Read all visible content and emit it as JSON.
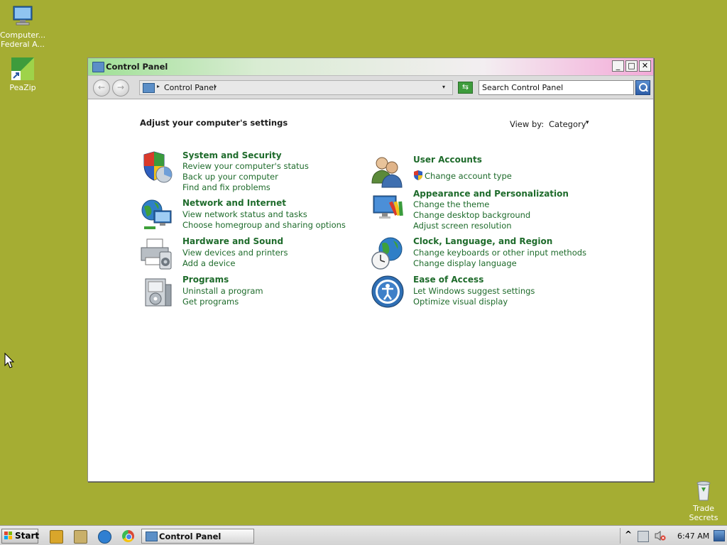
{
  "desktop": {
    "icons": [
      {
        "label": "Computer... Federal A..."
      },
      {
        "label": "PeaZip"
      },
      {
        "label": "Trade Secrets"
      }
    ]
  },
  "window": {
    "title": "Control Panel",
    "minimize_symbol": "_",
    "maximize_symbol": "□",
    "close_symbol": "✕",
    "toolbar": {
      "back_symbol": "←",
      "forward_symbol": "→",
      "breadcrumb_sep": "▸",
      "breadcrumb": "Control Panel",
      "breadcrumb_arrow": "▾",
      "dropdown_arrow": "▾",
      "refresh_symbol": "⇆",
      "search_placeholder": "Search Control Panel"
    },
    "content": {
      "heading": "Adjust your computer's settings",
      "view_by_label": "View by:",
      "view_by_value": "Category",
      "view_by_arrow": "▾",
      "categories_left": [
        {
          "title": "System and Security",
          "links": [
            "Review your computer's status",
            "Back up your computer",
            "Find and fix problems"
          ]
        },
        {
          "title": "Network and Internet",
          "links": [
            "View network status and tasks",
            "Choose homegroup and sharing options"
          ]
        },
        {
          "title": "Hardware and Sound",
          "links": [
            "View devices and printers",
            "Add a device"
          ]
        },
        {
          "title": "Programs",
          "links": [
            "Uninstall a program",
            "Get programs"
          ]
        }
      ],
      "categories_right": [
        {
          "title": "User Accounts",
          "links": [
            "Change account type"
          ]
        },
        {
          "title": "Appearance and Personalization",
          "links": [
            "Change the theme",
            "Change desktop background",
            "Adjust screen resolution"
          ]
        },
        {
          "title": "Clock, Language, and Region",
          "links": [
            "Change keyboards or other input methods",
            "Change display language"
          ]
        },
        {
          "title": "Ease of Access",
          "links": [
            "Let Windows suggest settings",
            "Optimize visual display"
          ]
        }
      ]
    }
  },
  "taskbar": {
    "start_label": "Start",
    "quick_launch": [
      {
        "name": "media-player-icon",
        "color": "#d9a62b"
      },
      {
        "name": "folder-icon",
        "color": "#c9b06a"
      },
      {
        "name": "internet-explorer-icon",
        "color": "#2f7fd1"
      },
      {
        "name": "chrome-icon",
        "color": "#d94a38"
      }
    ],
    "active_task": "Control Panel",
    "tray": {
      "expand_symbol": "^",
      "clock": "6:47 AM"
    }
  },
  "colors": {
    "desktop_background": "#a5ad33",
    "link_green": "#1e6b2b"
  }
}
